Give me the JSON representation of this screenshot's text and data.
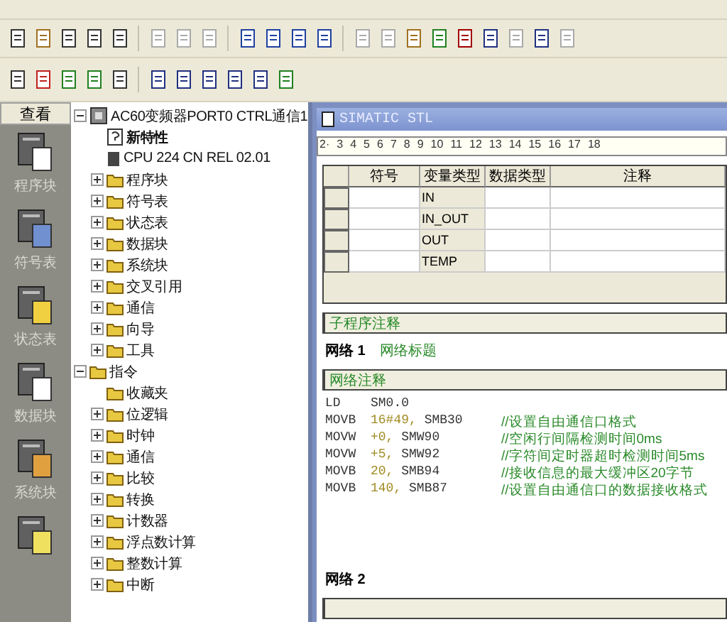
{
  "side_bar": {
    "title": "查看",
    "items": [
      {
        "label": "程序块",
        "kind": "program"
      },
      {
        "label": "符号表",
        "kind": "symbol"
      },
      {
        "label": "状态表",
        "kind": "status"
      },
      {
        "label": "数据块",
        "kind": "data"
      },
      {
        "label": "系统块",
        "kind": "system"
      },
      {
        "kind": "cross"
      }
    ]
  },
  "tree": [
    {
      "label": "AC60变频器PORT0 CTRL通信1",
      "kind": "project",
      "expanded": true,
      "children": [
        {
          "label": "新特性",
          "kind": "help"
        },
        {
          "label": "CPU 224 CN REL 02.01",
          "kind": "cpu"
        },
        {
          "label": "程序块",
          "kind": "folder",
          "expanded": false
        },
        {
          "label": "符号表",
          "kind": "folder",
          "expanded": false
        },
        {
          "label": "状态表",
          "kind": "folder",
          "expanded": false
        },
        {
          "label": "数据块",
          "kind": "folder",
          "expanded": false
        },
        {
          "label": "系统块",
          "kind": "folder",
          "expanded": false
        },
        {
          "label": "交叉引用",
          "kind": "folder",
          "expanded": false
        },
        {
          "label": "通信",
          "kind": "folder",
          "expanded": false
        },
        {
          "label": "向导",
          "kind": "folder",
          "expanded": false
        },
        {
          "label": "工具",
          "kind": "folder",
          "expanded": false
        }
      ]
    },
    {
      "label": "指令",
      "kind": "folder",
      "expanded": true,
      "children": [
        {
          "label": "收藏夹",
          "kind": "folder"
        },
        {
          "label": "位逻辑",
          "kind": "folder",
          "expanded": false
        },
        {
          "label": "时钟",
          "kind": "folder",
          "expanded": false
        },
        {
          "label": "通信",
          "kind": "folder",
          "expanded": false
        },
        {
          "label": "比较",
          "kind": "folder",
          "expanded": false
        },
        {
          "label": "转换",
          "kind": "folder",
          "expanded": false
        },
        {
          "label": "计数器",
          "kind": "folder",
          "expanded": false
        },
        {
          "label": "浮点数计算",
          "kind": "folder",
          "expanded": false
        },
        {
          "label": "整数计算",
          "kind": "folder",
          "expanded": false
        },
        {
          "label": "中断",
          "kind": "folder",
          "expanded": false
        }
      ]
    }
  ],
  "editor": {
    "title": "SIMATIC STL",
    "ruler": [
      "2·",
      "3",
      "4",
      "5",
      "6",
      "7",
      "8",
      "9",
      "10",
      "11",
      "12",
      "13",
      "14",
      "15",
      "16",
      "17",
      "18"
    ],
    "table": {
      "columns": [
        "符号",
        "变量类型",
        "数据类型",
        "注释"
      ],
      "rows": [
        {
          "var_type": "IN"
        },
        {
          "var_type": "IN_OUT"
        },
        {
          "var_type": "OUT"
        },
        {
          "var_type": "TEMP"
        }
      ]
    },
    "subroutine_comment": "子程序注释",
    "networks": [
      {
        "label": "网络 1",
        "title": "网络标题",
        "comment": "网络注释",
        "lines": [
          {
            "op": "LD",
            "operand": "SM0.0"
          },
          {
            "op": "MOVB",
            "value": "16#49,",
            "operand": "SMB30",
            "comment": "//设置自由通信口格式"
          },
          {
            "op": "MOVW",
            "value": "+0,",
            "operand": "SMW90",
            "comment": "//空闲行间隔检测时间0ms"
          },
          {
            "op": "MOVW",
            "value": "+5,",
            "operand": "SMW92",
            "comment": "//字符间定时器超时检测时间5ms"
          },
          {
            "op": "MOVB",
            "value": "20,",
            "operand": "SMB94",
            "comment": "//接收信息的最大缓冲区20字节"
          },
          {
            "op": "MOVB",
            "value": "140,",
            "operand": "SMB87",
            "comment": "//设置自由通信口的数据接收格式"
          }
        ]
      },
      {
        "label": "网络 2"
      }
    ]
  }
}
